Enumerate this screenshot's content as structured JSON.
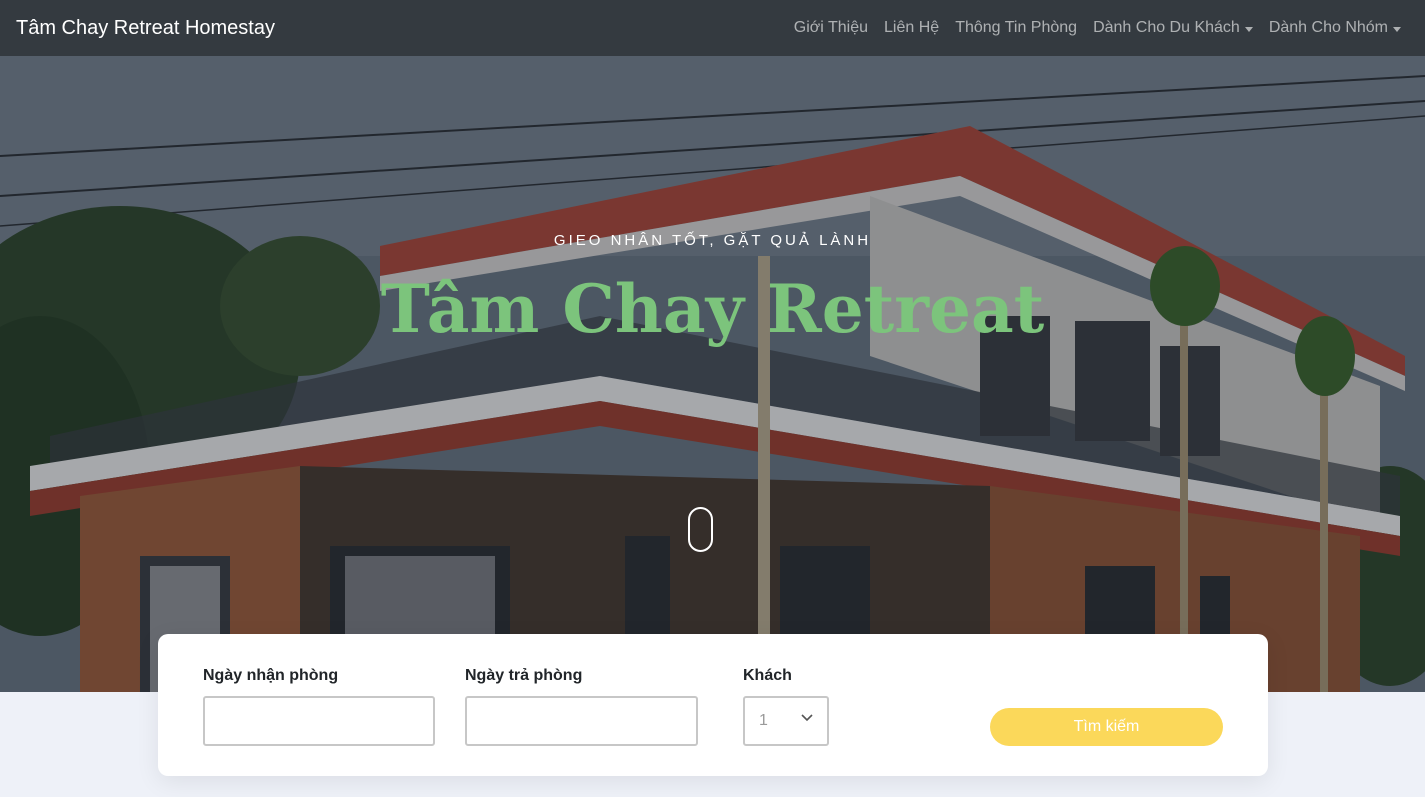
{
  "navbar": {
    "brand": "Tâm Chay Retreat Homestay",
    "links": [
      "Giới Thiệu",
      "Liên Hệ",
      "Thông Tin Phòng"
    ],
    "dropdowns": [
      "Dành Cho Du Khách",
      "Dành Cho Nhóm"
    ]
  },
  "hero": {
    "tagline": "GIEO NHÂN TỐT, GẶT QUẢ LÀNH",
    "title": "Tâm Chay Retreat",
    "title_color": "#7cc47c",
    "scroll_icon": "mouse-scroll-icon"
  },
  "search": {
    "checkin_label": "Ngày nhận phòng",
    "checkout_label": "Ngày trả phòng",
    "guests_label": "Khách",
    "guests_value": "1",
    "button_label": "Tìm kiếm",
    "button_color": "#fbd85a"
  }
}
